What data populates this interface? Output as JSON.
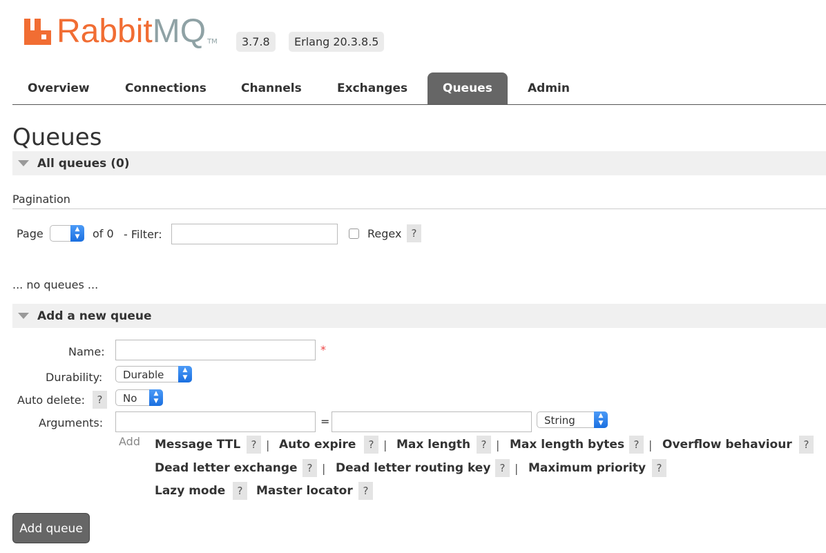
{
  "header": {
    "logo_rabbit": "Rabbit",
    "logo_mq": "MQ",
    "logo_tm": "TM",
    "version": "3.7.8",
    "erlang": "Erlang 20.3.8.5",
    "brand_color": "#f16d33"
  },
  "nav": {
    "tabs": [
      {
        "label": "Overview"
      },
      {
        "label": "Connections"
      },
      {
        "label": "Channels"
      },
      {
        "label": "Exchanges"
      },
      {
        "label": "Queues",
        "active": true
      },
      {
        "label": "Admin"
      }
    ]
  },
  "page_title": "Queues",
  "all_queues": {
    "title": "All queues (0)",
    "pagination_label": "Pagination",
    "page_label": "Page",
    "page_value": "",
    "of_label": "of 0",
    "filter_label": "- Filter:",
    "filter_value": "",
    "regex_label": "Regex",
    "regex_checked": false,
    "help": "?",
    "empty_text": "... no queues ..."
  },
  "add_queue": {
    "title": "Add a new queue",
    "name_label": "Name:",
    "name_value": "",
    "required_mark": "*",
    "durability_label": "Durability:",
    "durability_value": "Durable",
    "auto_delete_label": "Auto delete:",
    "auto_delete_value": "No",
    "arguments_label": "Arguments:",
    "equals": "=",
    "arg_type_value": "String",
    "add_label": "Add",
    "help": "?",
    "separator": "|",
    "arg_links": [
      "Message TTL",
      "Auto expire",
      "Max length",
      "Max length bytes",
      "Overflow behaviour",
      "Dead letter exchange",
      "Dead letter routing key",
      "Maximum priority",
      "Lazy mode",
      "Master locator"
    ],
    "submit_label": "Add queue"
  }
}
